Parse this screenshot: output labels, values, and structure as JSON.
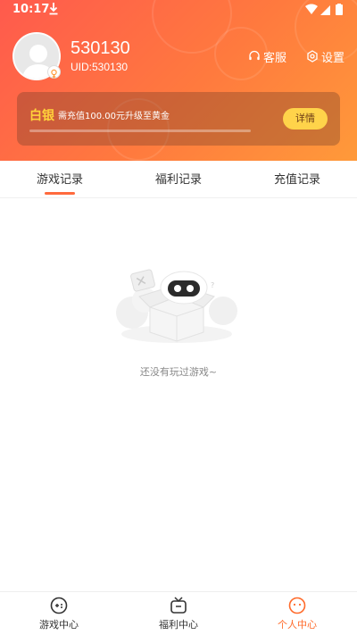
{
  "status_bar": {
    "time": "10:17"
  },
  "profile": {
    "username": "530130",
    "uid": "UID:530130"
  },
  "header_actions": {
    "service_label": "客服",
    "settings_label": "设置"
  },
  "vip": {
    "level": "白银",
    "description": "需充值100.00元升级至黄金",
    "progress_percent": 0,
    "detail_label": "详情"
  },
  "tabs": [
    {
      "label": "游戏记录",
      "active": true
    },
    {
      "label": "福利记录",
      "active": false
    },
    {
      "label": "充值记录",
      "active": false
    }
  ],
  "empty": {
    "message": "还没有玩过游戏~"
  },
  "bottom_nav": [
    {
      "label": "游戏中心",
      "icon": "gamepad-icon",
      "active": false
    },
    {
      "label": "福利中心",
      "icon": "tv-gift-icon",
      "active": false
    },
    {
      "label": "个人中心",
      "icon": "face-icon",
      "active": true
    }
  ],
  "colors": {
    "accent": "#ff6a2a",
    "header_start": "#ff5a4d",
    "header_end": "#ff9a3a",
    "gold": "#ffd23a"
  }
}
